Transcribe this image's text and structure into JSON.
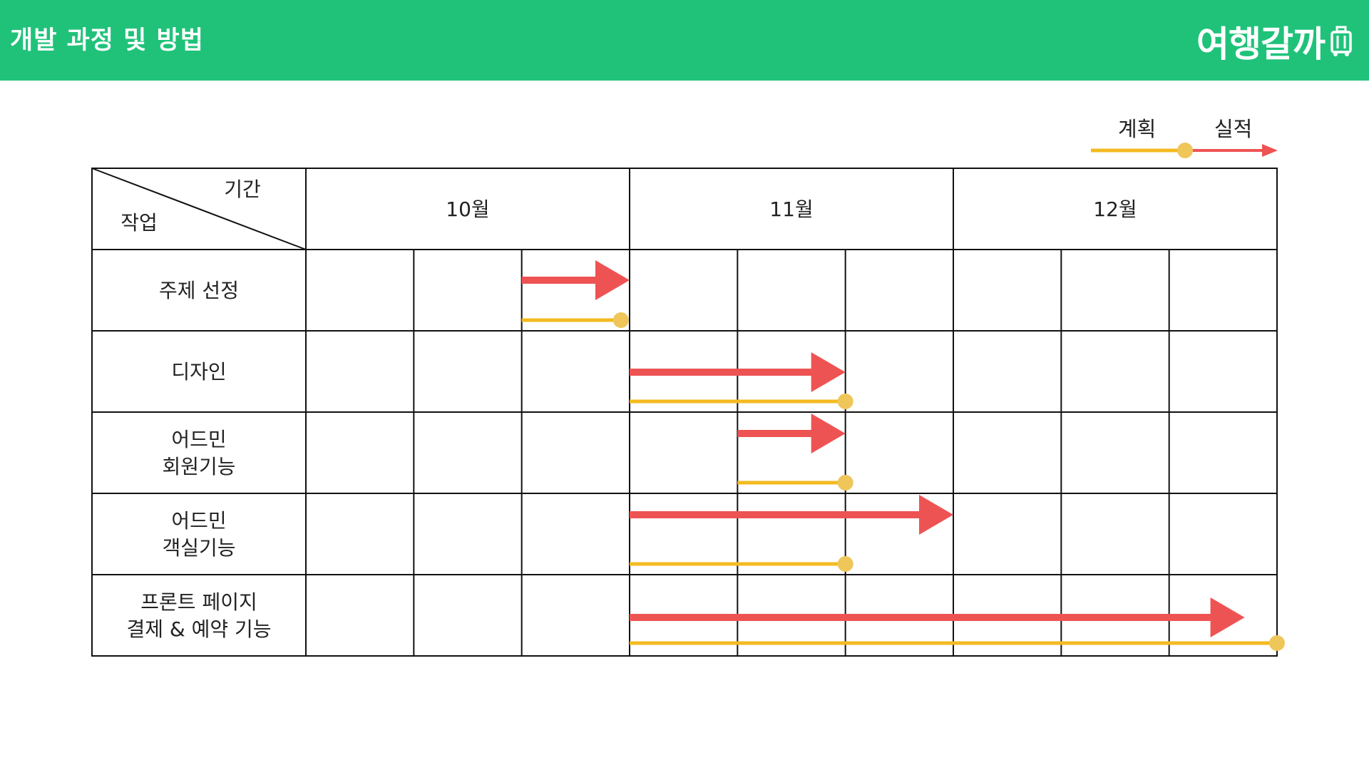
{
  "header": {
    "title": "개발 과정 및 방법",
    "brand": "여행갈까",
    "brand_color": "#20c27a"
  },
  "legend": {
    "plan_label": "계획",
    "actual_label": "실적"
  },
  "chart_data": {
    "type": "gantt",
    "corner": {
      "period_label": "기간",
      "task_label": "작업"
    },
    "months": [
      "10월",
      "11월",
      "12월"
    ],
    "periods_per_month": 3,
    "colors": {
      "plan": "#f3ba1f",
      "plan_dot": "#efc65a",
      "actual": "#ee5353",
      "grid": "#111111"
    },
    "tasks": [
      {
        "name": [
          "주제 선정"
        ],
        "actual": [
          2,
          3
        ],
        "plan": [
          2,
          2.92
        ]
      },
      {
        "name": [
          "디자인"
        ],
        "actual": [
          3,
          5
        ],
        "plan": [
          3,
          5
        ]
      },
      {
        "name": [
          "어드민",
          "회원기능"
        ],
        "actual": [
          4,
          5
        ],
        "plan": [
          4,
          5
        ]
      },
      {
        "name": [
          "어드민",
          "객실기능"
        ],
        "actual": [
          3,
          6
        ],
        "plan": [
          3,
          5
        ]
      },
      {
        "name": [
          "프론트 페이지",
          "결제 & 예약 기능"
        ],
        "actual": [
          3,
          8.7
        ],
        "plan": [
          3,
          9
        ]
      }
    ]
  }
}
